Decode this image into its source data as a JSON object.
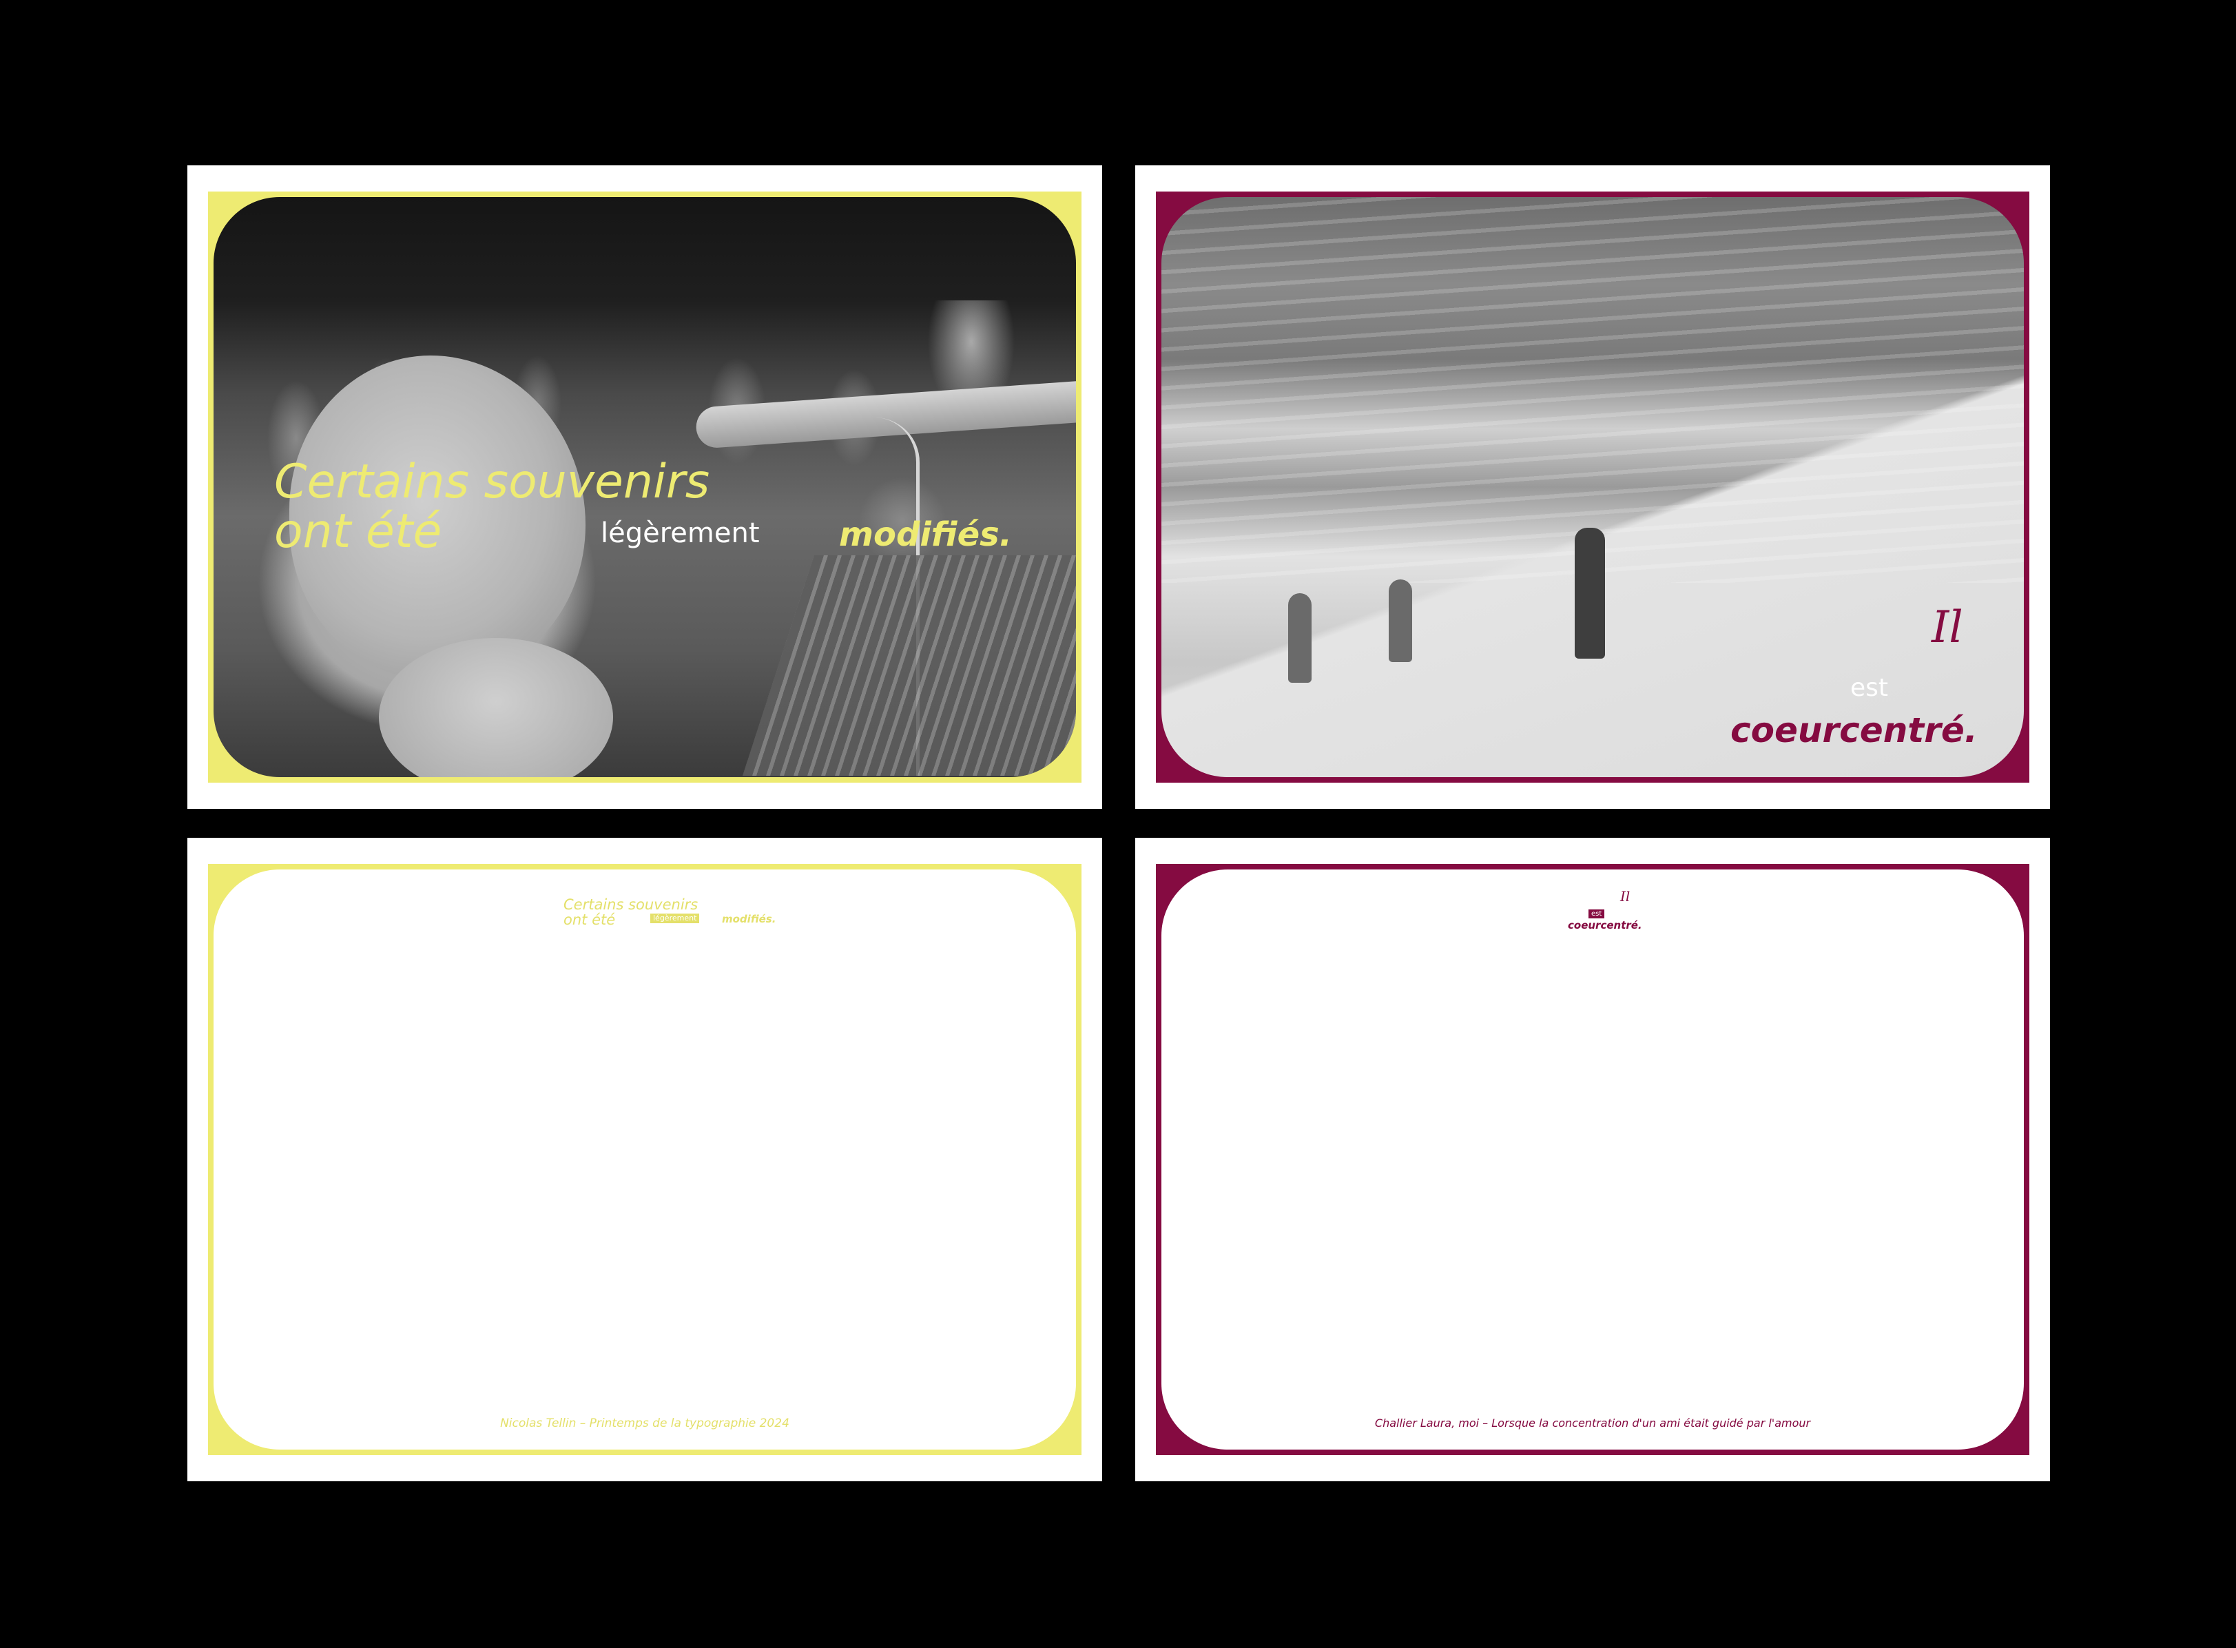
{
  "colors": {
    "background": "#000000",
    "card": "#ffffff",
    "yellow": "#eeeb72",
    "yellow_dim": "#e4e06a",
    "purple": "#850b41"
  },
  "cards": {
    "front_yellow": {
      "line1": "Certains souvenirs",
      "line2": "ont été",
      "middle": "légèrement",
      "emphasis": "modifiés."
    },
    "front_purple": {
      "line1": "Il",
      "middle": "est",
      "emphasis": "coeurcentré."
    },
    "back_yellow": {
      "logo_line1": "Certains souvenirs",
      "logo_line2": "ont été",
      "logo_middle": "légèrement",
      "logo_emphasis": "modifiés.",
      "footer": "Nicolas Tellin – Printemps de la typographie 2024"
    },
    "back_purple": {
      "logo_line1": "Il",
      "logo_middle": "est",
      "logo_emphasis": "coeurcentré.",
      "footer": "Challier Laura, moi – Lorsque la concentration d'un ami était guidé par l'amour"
    }
  }
}
